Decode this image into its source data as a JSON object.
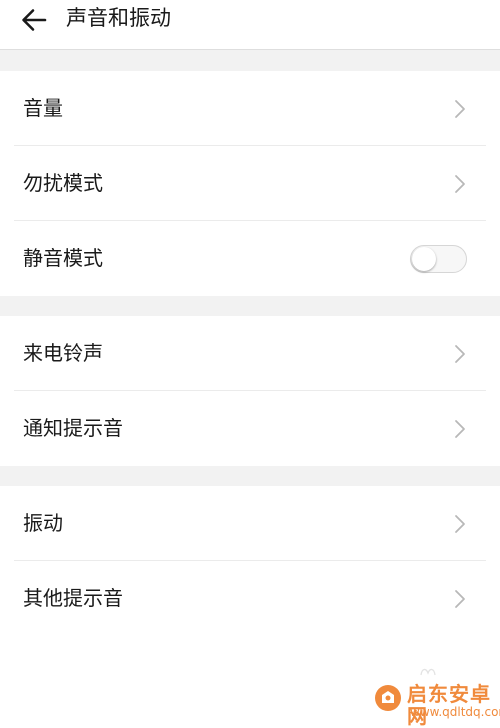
{
  "header": {
    "title": "声音和振动",
    "back_icon": "arrow-left-icon"
  },
  "groups": [
    {
      "items": [
        {
          "label": "音量",
          "control": "chevron-right-icon"
        },
        {
          "label": "勿扰模式",
          "control": "chevron-right-icon"
        },
        {
          "label": "静音模式",
          "control": "toggle",
          "toggle_on": false
        }
      ]
    },
    {
      "items": [
        {
          "label": "来电铃声",
          "control": "chevron-right-icon"
        },
        {
          "label": "通知提示音",
          "control": "chevron-right-icon"
        }
      ]
    },
    {
      "items": [
        {
          "label": "振动",
          "control": "chevron-right-icon"
        },
        {
          "label": "其他提示音",
          "control": "chevron-right-icon"
        }
      ]
    }
  ],
  "watermark": {
    "site_name": "启东安卓网",
    "site_url": "www.qdltdq.com",
    "accent_color": "#f08a3c"
  },
  "colors": {
    "background": "#ffffff",
    "section_gap": "#f2f2f2",
    "text": "#1a1a1a",
    "chevron": "#b8b8b8",
    "toggle_track": "#f7f7f7",
    "toggle_border": "#d6d6d6"
  }
}
